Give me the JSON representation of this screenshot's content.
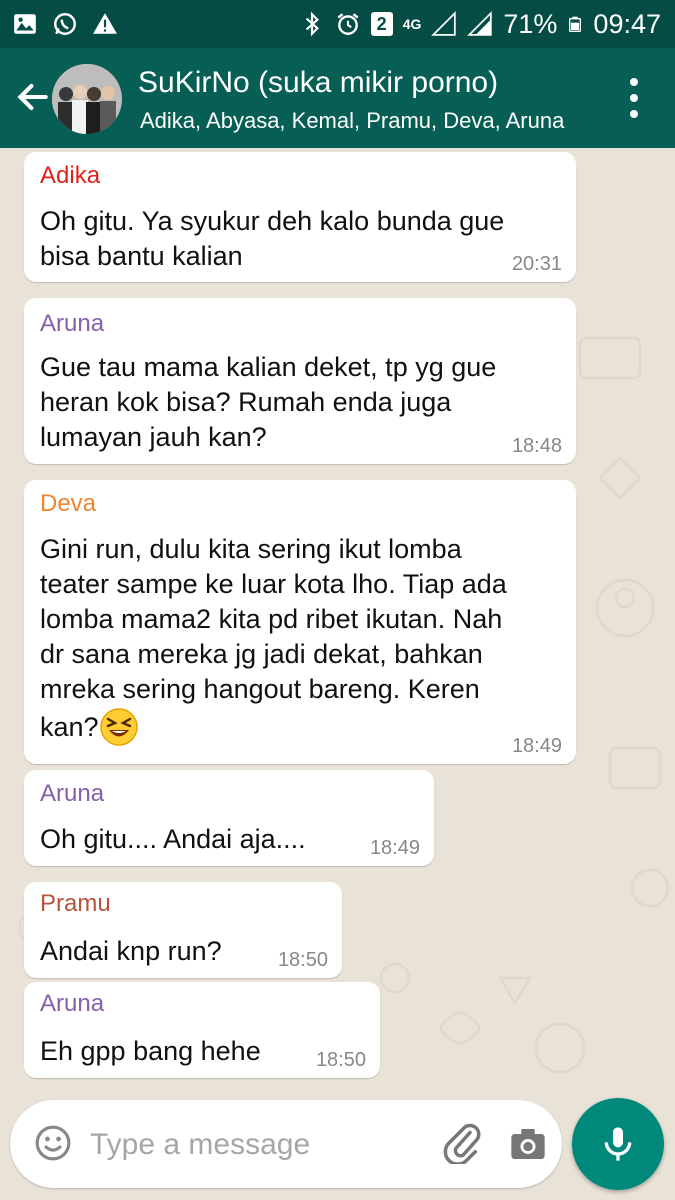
{
  "status_bar": {
    "sim_badge": "2",
    "network": "4G",
    "battery": "71%",
    "time": "09:47"
  },
  "header": {
    "title": "SuKirNo (suka mikir porno)",
    "members": "Adika, Abyasa, Kemal, Pramu, Deva, Aruna"
  },
  "messages": [
    {
      "sender": "Adika",
      "sender_color": "#e0201b",
      "lines": [
        "Oh gitu. Ya syukur deh kalo bunda gue",
        "bisa bantu kalian"
      ],
      "time": "20:31"
    },
    {
      "sender": "Aruna",
      "sender_color": "#8560a8",
      "lines": [
        "Gue tau mama kalian deket, tp yg gue",
        "heran kok bisa? Rumah enda juga",
        "lumayan jauh kan?"
      ],
      "time": "18:48"
    },
    {
      "sender": "Deva",
      "sender_color": "#f0852d",
      "lines": [
        "Gini run, dulu kita sering ikut lomba",
        "teater sampe ke luar kota lho. Tiap ada",
        "lomba mama2 kita pd ribet ikutan. Nah",
        "dr sana mereka jg jadi dekat, bahkan",
        "mreka sering hangout bareng. Keren",
        "kan?"
      ],
      "time": "18:49",
      "emoji": "laughing-squint-emoji"
    },
    {
      "sender": "Aruna",
      "sender_color": "#8560a8",
      "lines": [
        "Oh gitu.... Andai aja...."
      ],
      "time": "18:49"
    },
    {
      "sender": "Pramu",
      "sender_color": "#b5533c",
      "lines": [
        "Andai knp run?"
      ],
      "time": "18:50"
    },
    {
      "sender": "Aruna",
      "sender_color": "#8560a8",
      "lines": [
        "Eh gpp bang hehe"
      ],
      "time": "18:50"
    }
  ],
  "composer": {
    "placeholder": "Type a message"
  },
  "colors": {
    "header": "#075e54",
    "status_bar": "#054d44",
    "mic_button": "#00897b",
    "chat_bg": "#e9e2d7"
  }
}
